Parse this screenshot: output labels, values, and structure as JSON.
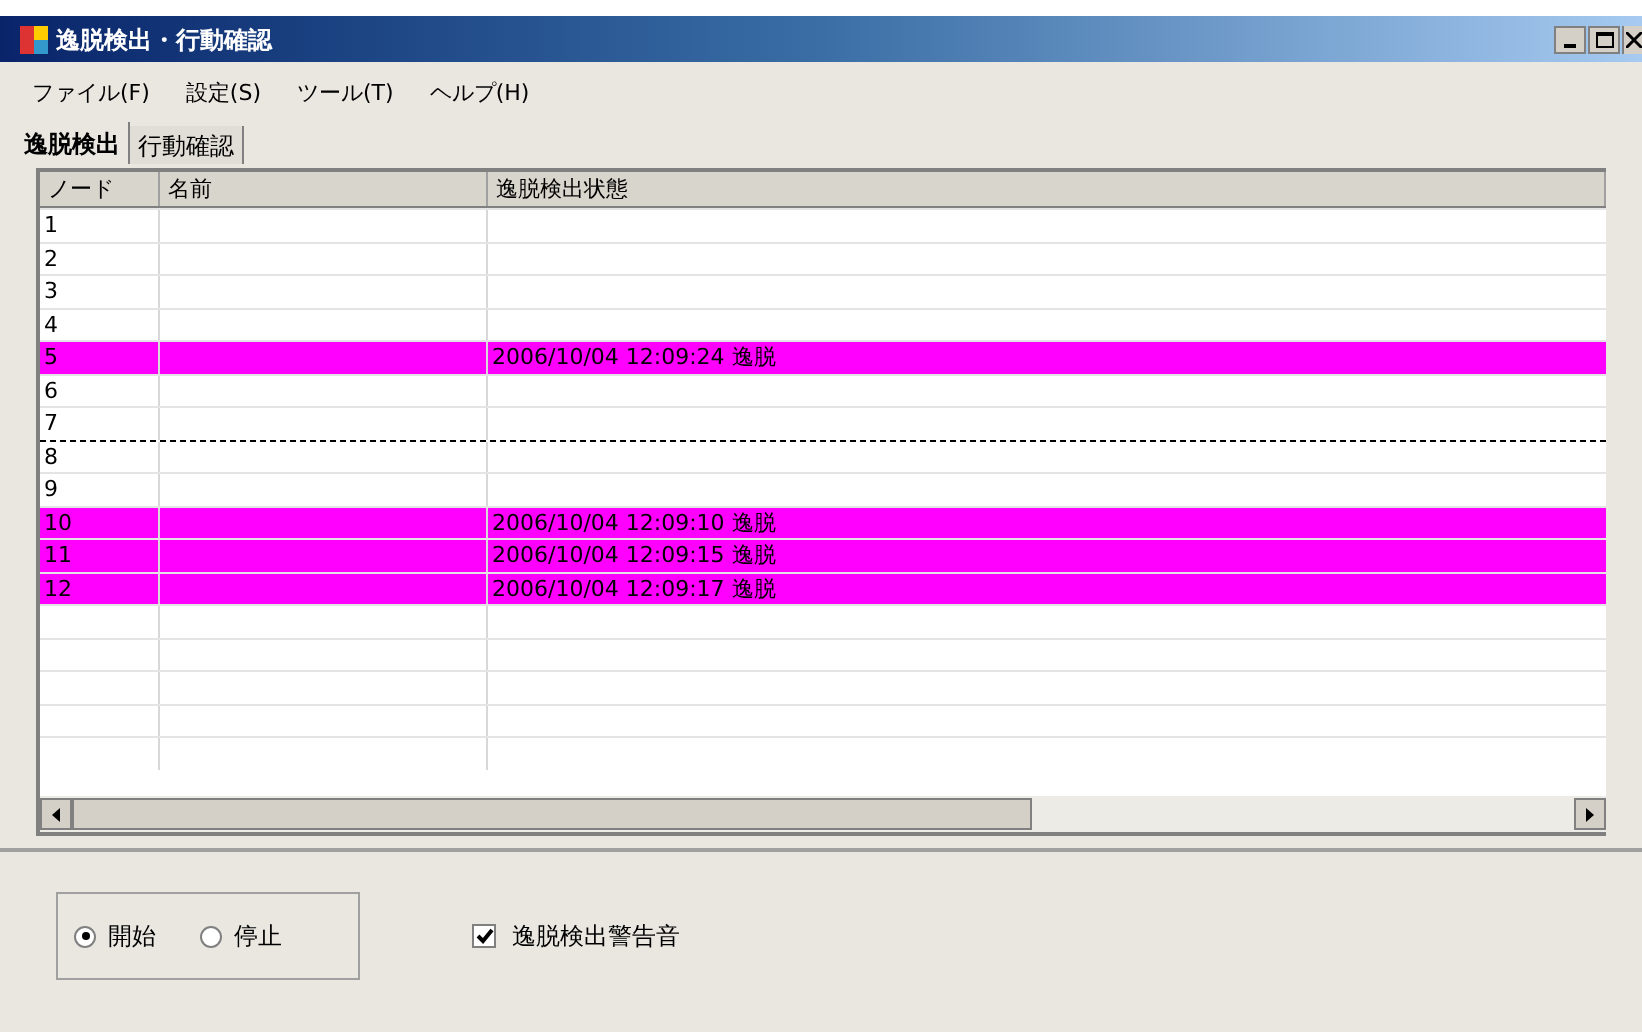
{
  "window": {
    "title": "逸脱検出・行動確認"
  },
  "menu": [
    "ファイル(F)",
    "設定(S)",
    "ツール(T)",
    "ヘルプ(H)"
  ],
  "tabs": [
    {
      "label": "逸脱検出",
      "selected": true
    },
    {
      "label": "行動確認",
      "selected": false
    }
  ],
  "table": {
    "columns": [
      "ノード",
      "名前",
      "逸脱検出状態"
    ],
    "rows": [
      {
        "node": "1",
        "alert": false,
        "focused": false
      },
      {
        "node": "2",
        "alert": false,
        "focused": false
      },
      {
        "node": "3",
        "alert": false,
        "focused": false
      },
      {
        "node": "4",
        "alert": false,
        "focused": false
      },
      {
        "node": "5",
        "status": "2006/10/04 12:09:24 逸脱",
        "alert": true,
        "focused": false
      },
      {
        "node": "6",
        "alert": false,
        "focused": false
      },
      {
        "node": "7",
        "alert": false,
        "focused": false
      },
      {
        "node": "8",
        "alert": false,
        "focused": true
      },
      {
        "node": "9",
        "alert": false,
        "focused": false
      },
      {
        "node": "10",
        "status": "2006/10/04 12:09:10 逸脱",
        "alert": true,
        "focused": false
      },
      {
        "node": "11",
        "status": "2006/10/04 12:09:15 逸脱",
        "alert": true,
        "focused": false
      },
      {
        "node": "12",
        "status": "2006/10/04 12:09:17 逸脱",
        "alert": true,
        "focused": false
      }
    ]
  },
  "mode": [
    {
      "label": "開始",
      "selected": true
    },
    {
      "label": "停止",
      "selected": false
    }
  ],
  "alarm_sound": {
    "label": "逸脱検出警告音",
    "checked": true
  }
}
